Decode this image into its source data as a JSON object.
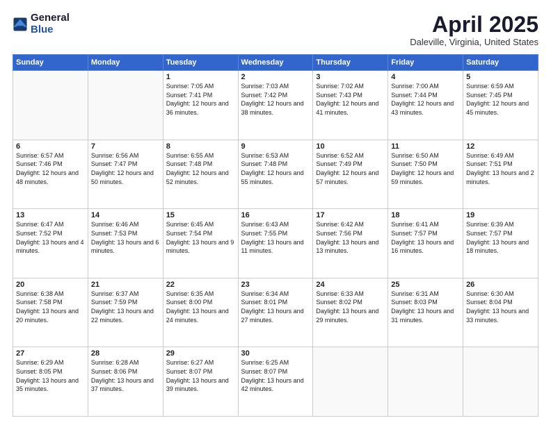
{
  "logo": {
    "general": "General",
    "blue": "Blue"
  },
  "title": {
    "month_year": "April 2025",
    "location": "Daleville, Virginia, United States"
  },
  "days_of_week": [
    "Sunday",
    "Monday",
    "Tuesday",
    "Wednesday",
    "Thursday",
    "Friday",
    "Saturday"
  ],
  "weeks": [
    [
      {
        "day": "",
        "info": ""
      },
      {
        "day": "",
        "info": ""
      },
      {
        "day": "1",
        "info": "Sunrise: 7:05 AM\nSunset: 7:41 PM\nDaylight: 12 hours and 36 minutes."
      },
      {
        "day": "2",
        "info": "Sunrise: 7:03 AM\nSunset: 7:42 PM\nDaylight: 12 hours and 38 minutes."
      },
      {
        "day": "3",
        "info": "Sunrise: 7:02 AM\nSunset: 7:43 PM\nDaylight: 12 hours and 41 minutes."
      },
      {
        "day": "4",
        "info": "Sunrise: 7:00 AM\nSunset: 7:44 PM\nDaylight: 12 hours and 43 minutes."
      },
      {
        "day": "5",
        "info": "Sunrise: 6:59 AM\nSunset: 7:45 PM\nDaylight: 12 hours and 45 minutes."
      }
    ],
    [
      {
        "day": "6",
        "info": "Sunrise: 6:57 AM\nSunset: 7:46 PM\nDaylight: 12 hours and 48 minutes."
      },
      {
        "day": "7",
        "info": "Sunrise: 6:56 AM\nSunset: 7:47 PM\nDaylight: 12 hours and 50 minutes."
      },
      {
        "day": "8",
        "info": "Sunrise: 6:55 AM\nSunset: 7:48 PM\nDaylight: 12 hours and 52 minutes."
      },
      {
        "day": "9",
        "info": "Sunrise: 6:53 AM\nSunset: 7:48 PM\nDaylight: 12 hours and 55 minutes."
      },
      {
        "day": "10",
        "info": "Sunrise: 6:52 AM\nSunset: 7:49 PM\nDaylight: 12 hours and 57 minutes."
      },
      {
        "day": "11",
        "info": "Sunrise: 6:50 AM\nSunset: 7:50 PM\nDaylight: 12 hours and 59 minutes."
      },
      {
        "day": "12",
        "info": "Sunrise: 6:49 AM\nSunset: 7:51 PM\nDaylight: 13 hours and 2 minutes."
      }
    ],
    [
      {
        "day": "13",
        "info": "Sunrise: 6:47 AM\nSunset: 7:52 PM\nDaylight: 13 hours and 4 minutes."
      },
      {
        "day": "14",
        "info": "Sunrise: 6:46 AM\nSunset: 7:53 PM\nDaylight: 13 hours and 6 minutes."
      },
      {
        "day": "15",
        "info": "Sunrise: 6:45 AM\nSunset: 7:54 PM\nDaylight: 13 hours and 9 minutes."
      },
      {
        "day": "16",
        "info": "Sunrise: 6:43 AM\nSunset: 7:55 PM\nDaylight: 13 hours and 11 minutes."
      },
      {
        "day": "17",
        "info": "Sunrise: 6:42 AM\nSunset: 7:56 PM\nDaylight: 13 hours and 13 minutes."
      },
      {
        "day": "18",
        "info": "Sunrise: 6:41 AM\nSunset: 7:57 PM\nDaylight: 13 hours and 16 minutes."
      },
      {
        "day": "19",
        "info": "Sunrise: 6:39 AM\nSunset: 7:57 PM\nDaylight: 13 hours and 18 minutes."
      }
    ],
    [
      {
        "day": "20",
        "info": "Sunrise: 6:38 AM\nSunset: 7:58 PM\nDaylight: 13 hours and 20 minutes."
      },
      {
        "day": "21",
        "info": "Sunrise: 6:37 AM\nSunset: 7:59 PM\nDaylight: 13 hours and 22 minutes."
      },
      {
        "day": "22",
        "info": "Sunrise: 6:35 AM\nSunset: 8:00 PM\nDaylight: 13 hours and 24 minutes."
      },
      {
        "day": "23",
        "info": "Sunrise: 6:34 AM\nSunset: 8:01 PM\nDaylight: 13 hours and 27 minutes."
      },
      {
        "day": "24",
        "info": "Sunrise: 6:33 AM\nSunset: 8:02 PM\nDaylight: 13 hours and 29 minutes."
      },
      {
        "day": "25",
        "info": "Sunrise: 6:31 AM\nSunset: 8:03 PM\nDaylight: 13 hours and 31 minutes."
      },
      {
        "day": "26",
        "info": "Sunrise: 6:30 AM\nSunset: 8:04 PM\nDaylight: 13 hours and 33 minutes."
      }
    ],
    [
      {
        "day": "27",
        "info": "Sunrise: 6:29 AM\nSunset: 8:05 PM\nDaylight: 13 hours and 35 minutes."
      },
      {
        "day": "28",
        "info": "Sunrise: 6:28 AM\nSunset: 8:06 PM\nDaylight: 13 hours and 37 minutes."
      },
      {
        "day": "29",
        "info": "Sunrise: 6:27 AM\nSunset: 8:07 PM\nDaylight: 13 hours and 39 minutes."
      },
      {
        "day": "30",
        "info": "Sunrise: 6:25 AM\nSunset: 8:07 PM\nDaylight: 13 hours and 42 minutes."
      },
      {
        "day": "",
        "info": ""
      },
      {
        "day": "",
        "info": ""
      },
      {
        "day": "",
        "info": ""
      }
    ]
  ]
}
